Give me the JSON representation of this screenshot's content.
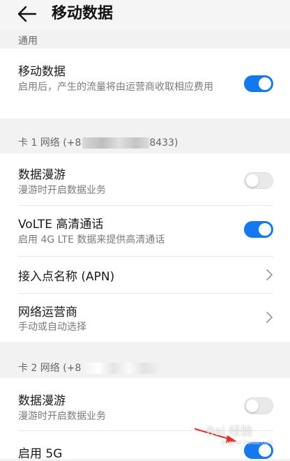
{
  "header": {
    "title": "移动数据"
  },
  "sections": {
    "general": {
      "label": "通用"
    },
    "sim1": {
      "label_prefix": "卡 1 网络 (+8",
      "label_suffix": "8433)"
    },
    "sim2": {
      "label_prefix": "卡 2 网络 (+8"
    }
  },
  "rows": {
    "mobile_data": {
      "title": "移动数据",
      "description": "启用后，产生的流量将由运营商收取相应费用",
      "enabled": true
    },
    "roaming1": {
      "title": "数据漫游",
      "description": "漫游时开启数据业务",
      "enabled": false
    },
    "volte": {
      "title": "VoLTE 高清通话",
      "description": "启用 4G LTE 数据来提供高清通话",
      "enabled": true
    },
    "apn": {
      "title": "接入点名称 (APN)"
    },
    "carrier": {
      "title": "网络运营商",
      "description": "手动或自动选择"
    },
    "roaming2": {
      "title": "数据漫游",
      "description": "漫游时开启数据业务",
      "enabled": false
    },
    "enable_5g": {
      "title": "启用 5G",
      "enabled": true
    }
  },
  "watermark": {
    "text": "Bai 经验",
    "subtext": "jingyan.baidu.com"
  },
  "colors": {
    "accent": "#1478ee",
    "toggle_off": "#e9e9e9",
    "background": "#f2f2f2",
    "annotation_arrow": "#e0302a"
  },
  "icons": {
    "back": "arrow-left-icon",
    "chevron": "chevron-right-icon"
  }
}
